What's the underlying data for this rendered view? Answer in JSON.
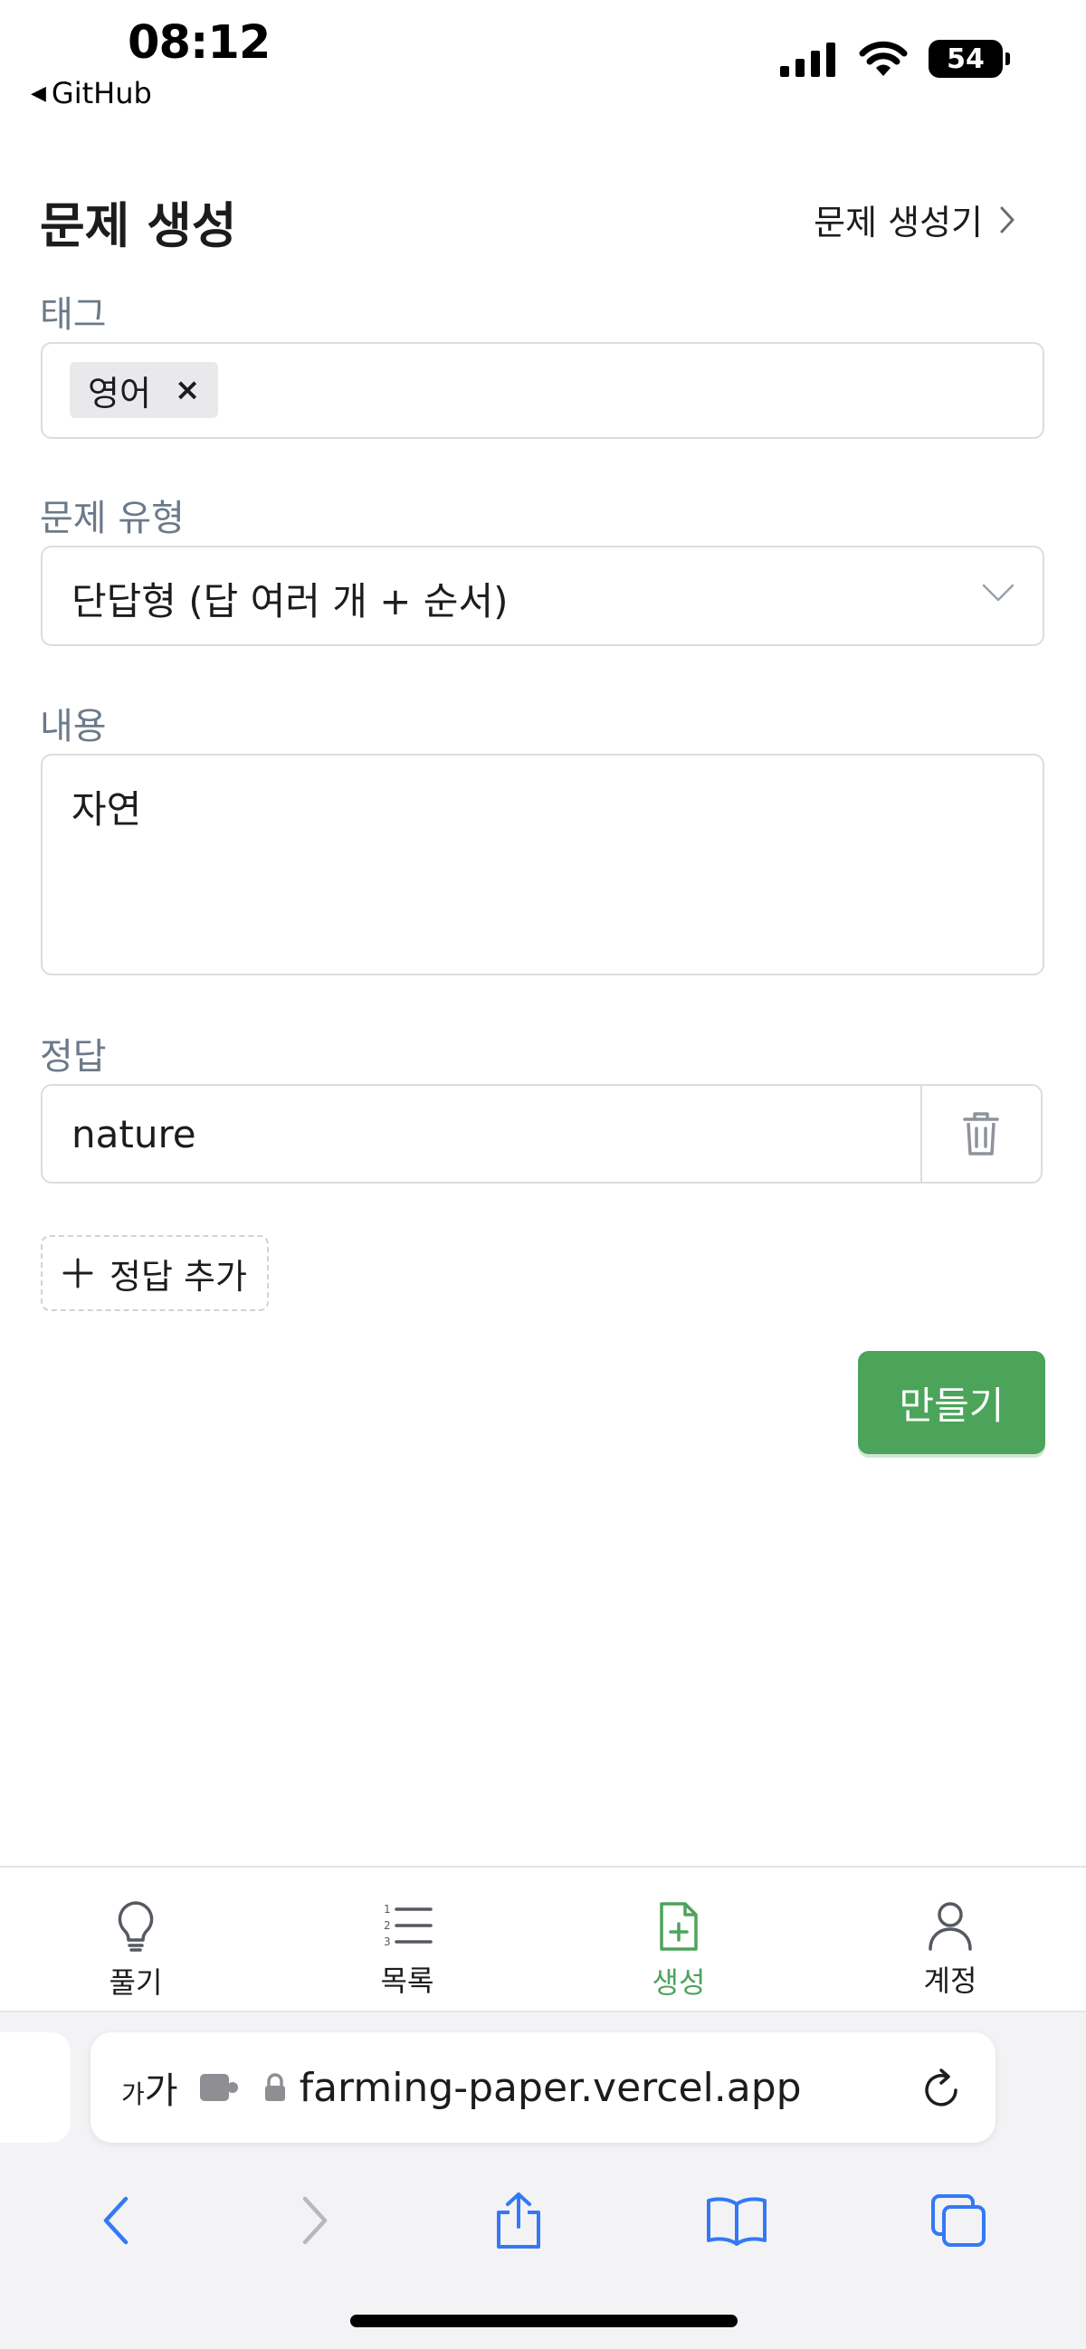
{
  "status_bar": {
    "time": "08:12",
    "back_label": "GitHub",
    "battery": "54"
  },
  "header": {
    "title": "문제 생성",
    "generator_link": "문제 생성기"
  },
  "tags": {
    "label": "태그",
    "chips": [
      "영어"
    ],
    "remove_glyph": "×"
  },
  "question_type": {
    "label": "문제 유형",
    "value": "단답형 (답 여러 개 + 순서)"
  },
  "content": {
    "label": "내용",
    "value": "자연"
  },
  "answers": {
    "label": "정답",
    "items": [
      "nature"
    ],
    "add_label": "정답 추가"
  },
  "submit": {
    "label": "만들기"
  },
  "bottom_nav": {
    "items": [
      {
        "label": "풀기",
        "icon": "lightbulb-icon"
      },
      {
        "label": "목록",
        "icon": "numbered-list-icon"
      },
      {
        "label": "생성",
        "icon": "file-plus-icon"
      },
      {
        "label": "계정",
        "icon": "user-icon"
      }
    ],
    "active": "생성"
  },
  "browser": {
    "aa_small": "가",
    "aa_large": "가",
    "url": "farming-paper.vercel.app"
  },
  "colors": {
    "accent": "#4ca45a",
    "label": "#6b7a8a",
    "border": "#d9dde3",
    "safari_blue": "#3478f6"
  }
}
